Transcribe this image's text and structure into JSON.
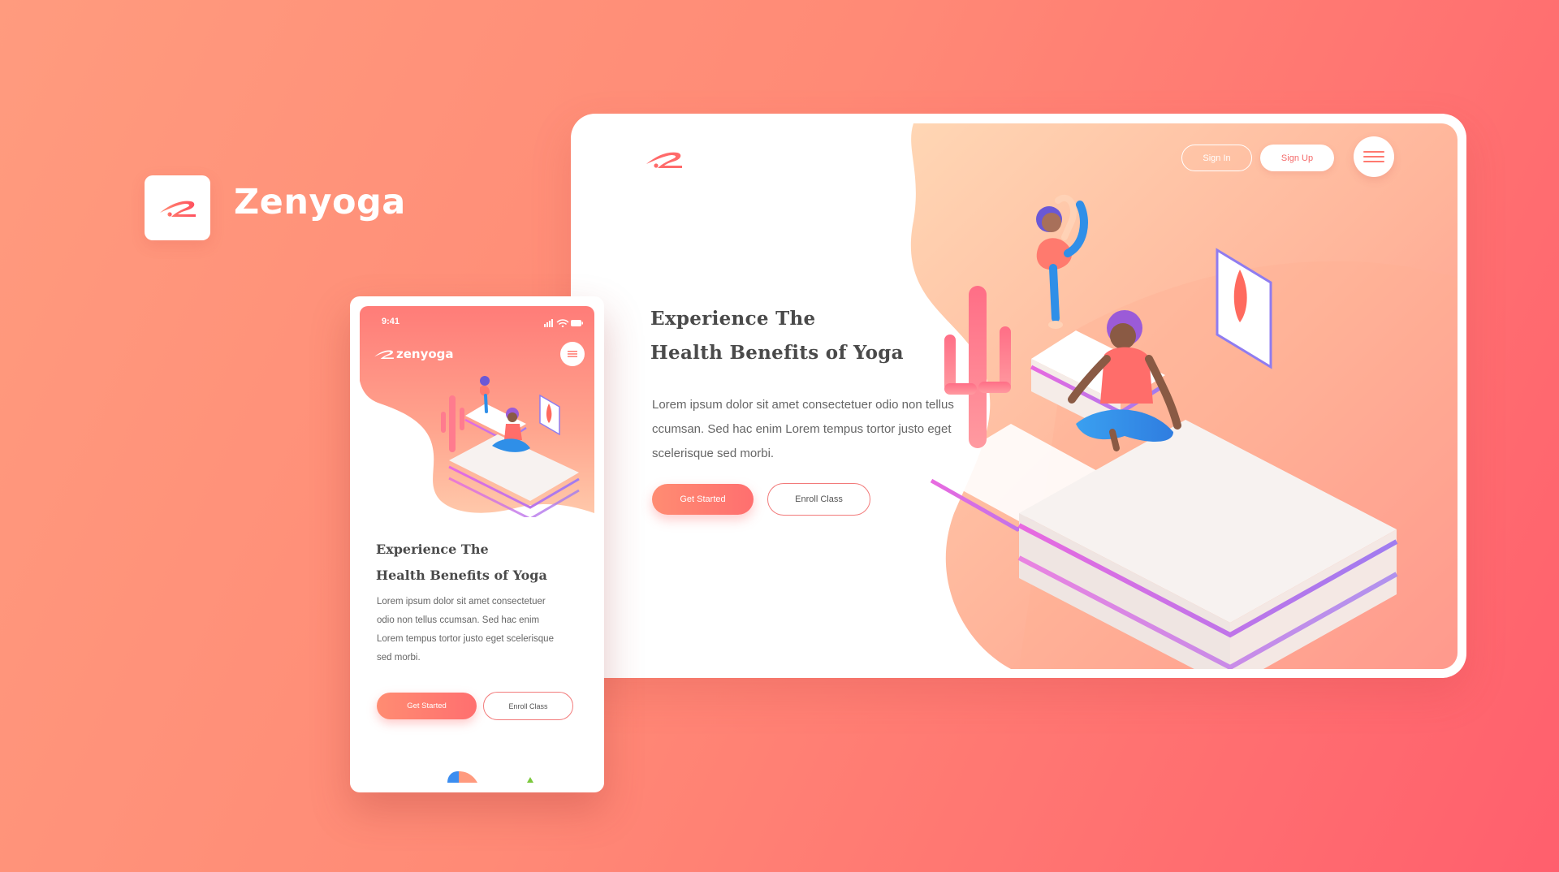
{
  "brand": {
    "name": "Zenyoga",
    "logo_icon": "zenyoga-swoosh-logo",
    "accent_color": "#ff6f6f"
  },
  "desktop": {
    "nav": {
      "sign_in": "Sign In",
      "sign_up": "Sign Up",
      "menu_icon": "hamburger-icon"
    },
    "hero": {
      "title_line1": "Experience The",
      "title_line2": "Health Benefits of Yoga",
      "text_line1": "Lorem ipsum dolor sit amet consectetuer odio non tellus",
      "text_line2": "ccumsan. Sed hac enim Lorem tempus tortor justo eget",
      "text_line3": "scelerisque sed morbi.",
      "primary_button": "Get Started",
      "secondary_button": "Enroll Class"
    }
  },
  "mobile": {
    "status": {
      "time": "9:41",
      "icons": [
        "signal-icon",
        "wifi-icon",
        "battery-icon"
      ]
    },
    "brand_name": "zenyoga",
    "menu_icon": "hamburger-icon",
    "hero": {
      "title_line1": "Experience The",
      "title_line2": "Health Benefits of Yoga",
      "text_line1": "Lorem ipsum dolor sit amet consectetuer",
      "text_line2": "odio non tellus  ccumsan. Sed hac enim",
      "text_line3": "Lorem tempus tortor justo eget  scelerisque",
      "text_line4": "sed morbi.",
      "primary_button": "Get Started",
      "secondary_button": "Enroll Class"
    }
  }
}
